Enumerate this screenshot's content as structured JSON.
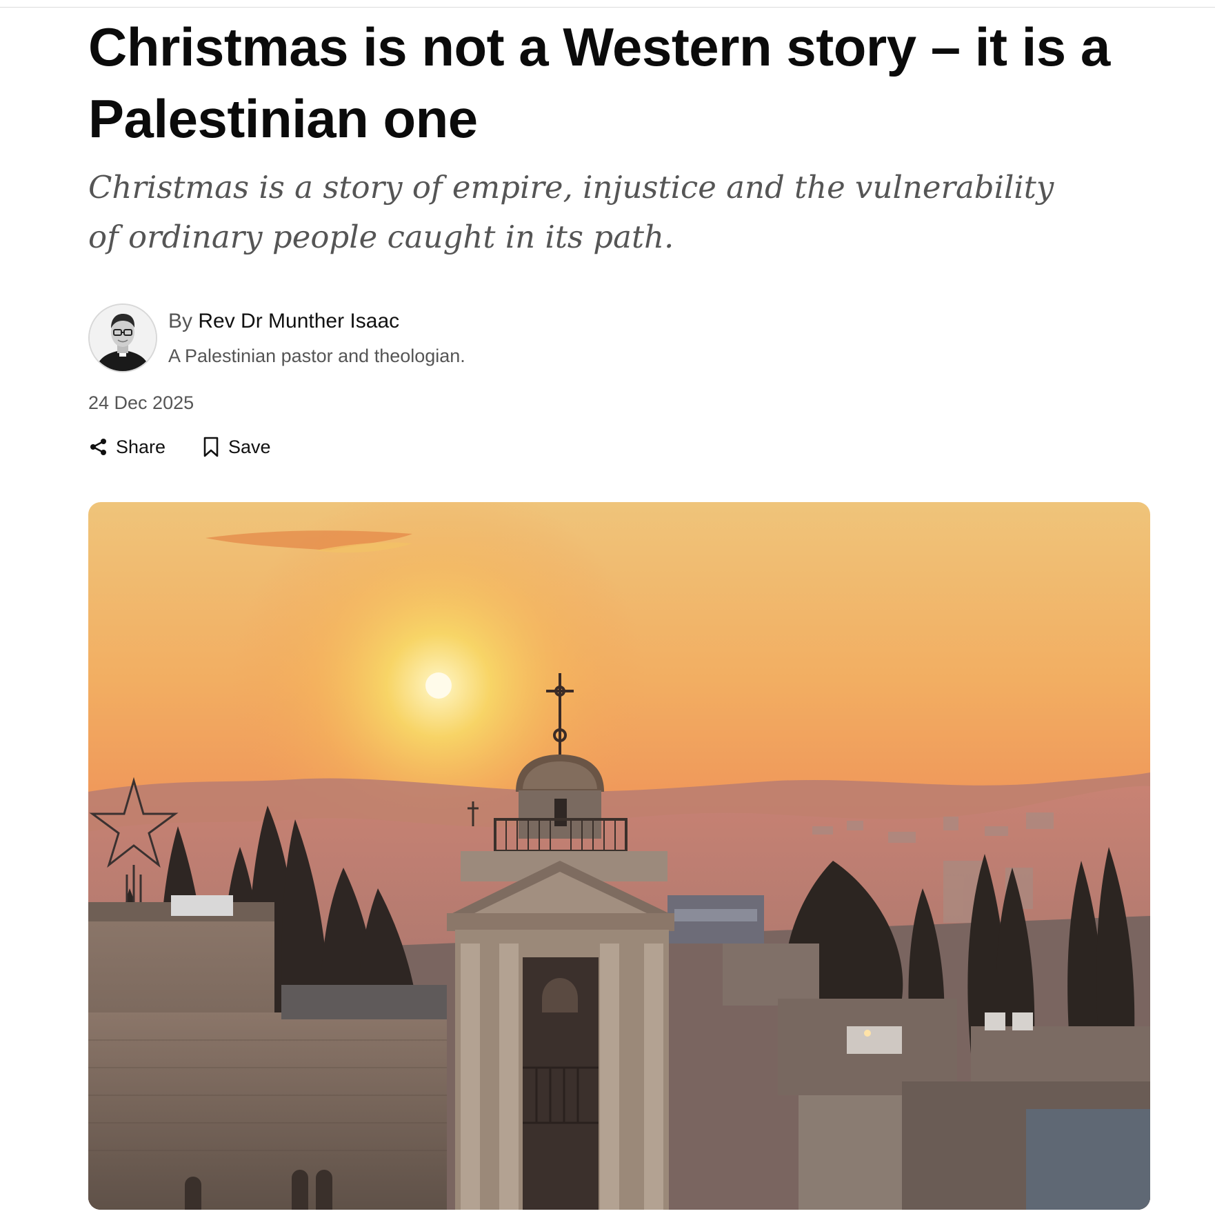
{
  "article": {
    "headline": "Christmas is not a Western story – it is a Palestinian one",
    "standfirst": "Christmas is a story of empire, injustice and the vulnerability of ordinary people caught in its path.",
    "byline": {
      "prefix": "By",
      "author": "Rev Dr Munther Isaac",
      "bio": "A Palestinian pastor and theologian."
    },
    "date": "24 Dec 2025"
  },
  "actions": {
    "share_label": "Share",
    "share_icon": "share-icon",
    "save_label": "Save",
    "save_icon": "bookmark-icon"
  },
  "hero_image": {
    "subject": "Sunset over Bethlehem with a church bell tower topped by a cross",
    "sky_colors": [
      "#f0c070",
      "#f3a05a",
      "#e9855a"
    ]
  }
}
